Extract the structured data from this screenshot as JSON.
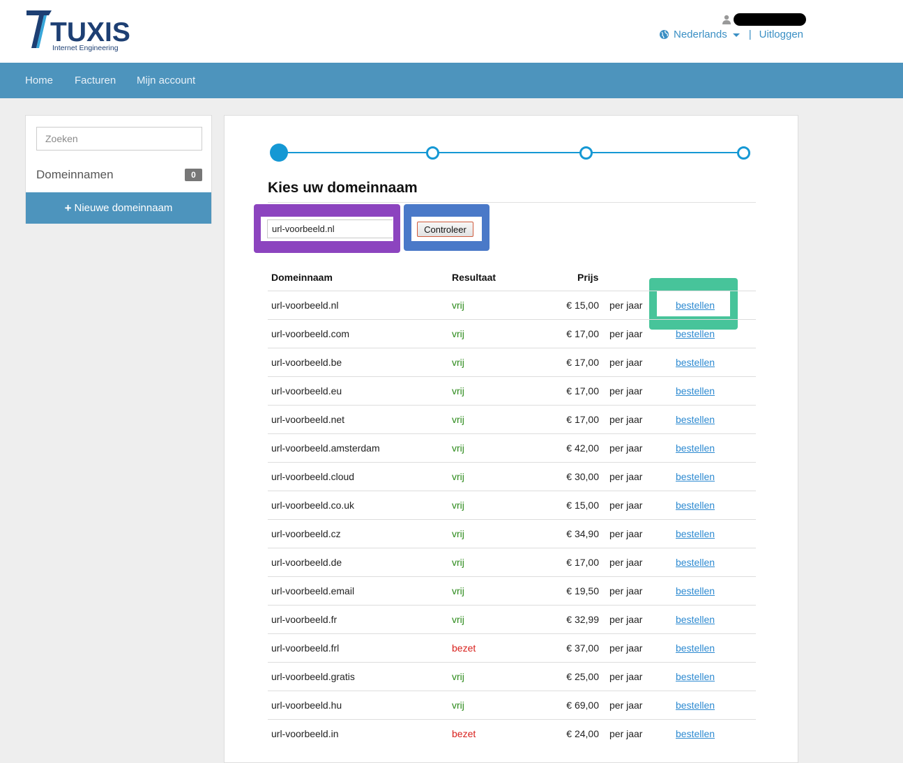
{
  "header": {
    "logo_text": "TUXIS",
    "logo_subtitle": "Internet Engineering",
    "language": "Nederlands",
    "separator": "|",
    "logout": "Uitloggen"
  },
  "nav": {
    "items": [
      "Home",
      "Facturen",
      "Mijn account"
    ]
  },
  "sidebar": {
    "search_placeholder": "Zoeken",
    "domains_label": "Domeinnamen",
    "domains_count": "0",
    "new_domain_label": "Nieuwe domeinnaam"
  },
  "wizard": {
    "total_steps": 4,
    "current_step": 1
  },
  "main": {
    "title": "Kies uw domeinnaam",
    "domain_input_value": "url-voorbeeld.nl",
    "check_button": "Controleer",
    "columns": {
      "domain": "Domeinnaam",
      "result": "Resultaat",
      "price": "Prijs"
    },
    "rows": [
      {
        "domain": "url-voorbeeld.nl",
        "result": "vrij",
        "status": "free",
        "price": "€ 15,00",
        "period": "per jaar",
        "action": "bestellen"
      },
      {
        "domain": "url-voorbeeld.com",
        "result": "vrij",
        "status": "free",
        "price": "€ 17,00",
        "period": "per jaar",
        "action": "bestellen"
      },
      {
        "domain": "url-voorbeeld.be",
        "result": "vrij",
        "status": "free",
        "price": "€ 17,00",
        "period": "per jaar",
        "action": "bestellen"
      },
      {
        "domain": "url-voorbeeld.eu",
        "result": "vrij",
        "status": "free",
        "price": "€ 17,00",
        "period": "per jaar",
        "action": "bestellen"
      },
      {
        "domain": "url-voorbeeld.net",
        "result": "vrij",
        "status": "free",
        "price": "€ 17,00",
        "period": "per jaar",
        "action": "bestellen"
      },
      {
        "domain": "url-voorbeeld.amsterdam",
        "result": "vrij",
        "status": "free",
        "price": "€ 42,00",
        "period": "per jaar",
        "action": "bestellen"
      },
      {
        "domain": "url-voorbeeld.cloud",
        "result": "vrij",
        "status": "free",
        "price": "€ 30,00",
        "period": "per jaar",
        "action": "bestellen"
      },
      {
        "domain": "url-voorbeeld.co.uk",
        "result": "vrij",
        "status": "free",
        "price": "€ 15,00",
        "period": "per jaar",
        "action": "bestellen"
      },
      {
        "domain": "url-voorbeeld.cz",
        "result": "vrij",
        "status": "free",
        "price": "€ 34,90",
        "period": "per jaar",
        "action": "bestellen"
      },
      {
        "domain": "url-voorbeeld.de",
        "result": "vrij",
        "status": "free",
        "price": "€ 17,00",
        "period": "per jaar",
        "action": "bestellen"
      },
      {
        "domain": "url-voorbeeld.email",
        "result": "vrij",
        "status": "free",
        "price": "€ 19,50",
        "period": "per jaar",
        "action": "bestellen"
      },
      {
        "domain": "url-voorbeeld.fr",
        "result": "vrij",
        "status": "free",
        "price": "€ 32,99",
        "period": "per jaar",
        "action": "bestellen"
      },
      {
        "domain": "url-voorbeeld.frl",
        "result": "bezet",
        "status": "taken",
        "price": "€ 37,00",
        "period": "per jaar",
        "action": "bestellen"
      },
      {
        "domain": "url-voorbeeld.gratis",
        "result": "vrij",
        "status": "free",
        "price": "€ 25,00",
        "period": "per jaar",
        "action": "bestellen"
      },
      {
        "domain": "url-voorbeeld.hu",
        "result": "vrij",
        "status": "free",
        "price": "€ 69,00",
        "period": "per jaar",
        "action": "bestellen"
      },
      {
        "domain": "url-voorbeeld.in",
        "result": "bezet",
        "status": "taken",
        "price": "€ 24,00",
        "period": "per jaar",
        "action": "bestellen"
      }
    ]
  },
  "colors": {
    "brand_dark": "#1d3f73",
    "brand_light": "#1598d4",
    "navbar": "#4d94bd",
    "link": "#2d8ad1",
    "free": "#2b8a1a",
    "taken": "#d8201c",
    "highlight_input": "#8c44bf",
    "highlight_button": "#4a79c8",
    "highlight_order": "#47c49a"
  },
  "icons": {
    "user": "user-icon",
    "language": "globe-icon",
    "dropdown": "caret-down-icon",
    "add": "plus-icon"
  }
}
